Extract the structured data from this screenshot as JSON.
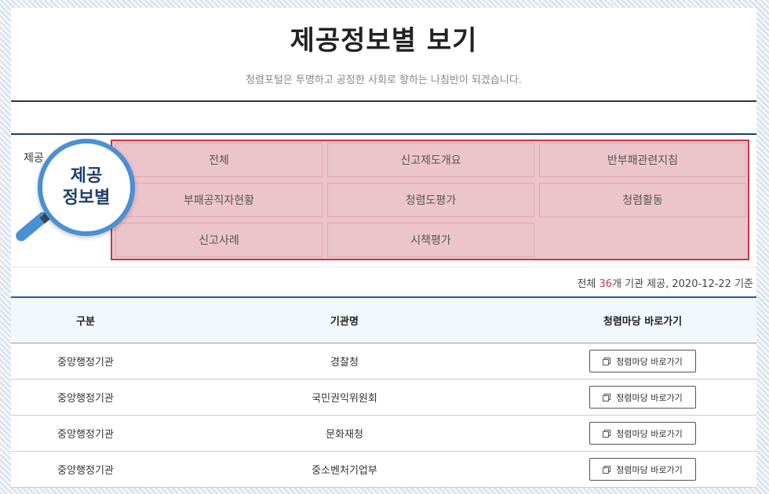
{
  "header": {
    "title": "제공정보별 보기",
    "subtitle": "청렴포털은 투명하고 공정한 사회로 향하는 나침반이 되겠습니다."
  },
  "filter": {
    "label": "제공",
    "badge_line1": "제공",
    "badge_line2": "정보별",
    "categories": [
      "전체",
      "신고제도개요",
      "반부패관련지침",
      "부패공직자현황",
      "청렴도평가",
      "청렴활동",
      "신고사례",
      "시책평가"
    ]
  },
  "summary": {
    "prefix": "전체 ",
    "count": "36",
    "suffix": "개 기관 제공, 2020-12-22 기준"
  },
  "table": {
    "columns": [
      "구분",
      "기관명",
      "청렴마당 바로가기"
    ],
    "button_label": "청렴마당 바로가기",
    "rows": [
      {
        "category": "중앙행정기관",
        "agency": "경찰청"
      },
      {
        "category": "중앙행정기관",
        "agency": "국민권익위원회"
      },
      {
        "category": "중앙행정기관",
        "agency": "문화재청"
      },
      {
        "category": "중앙행정기관",
        "agency": "중소벤처기업부"
      }
    ]
  },
  "colors": {
    "accent": "#1f5fa0",
    "highlight_border": "#c23a4e",
    "highlight_fill": "#ecc4cb",
    "badge_ring": "#4a90d4"
  }
}
